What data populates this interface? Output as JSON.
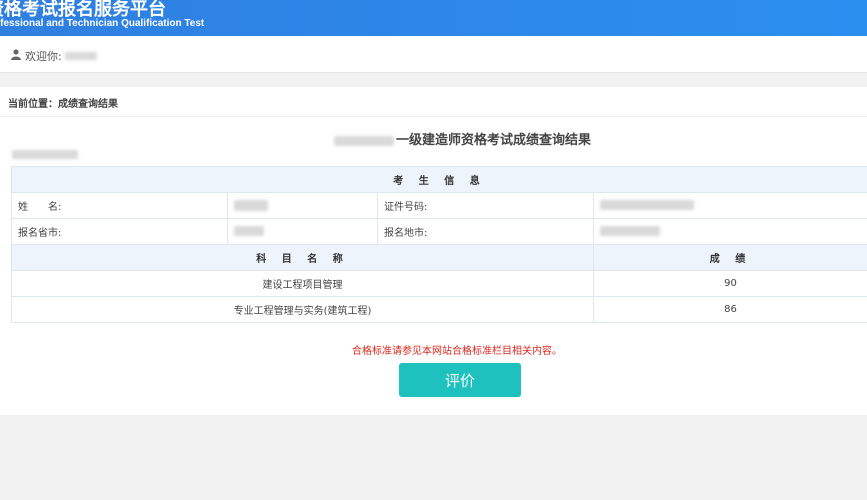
{
  "header": {
    "title_cn": "资格考试报名服务平台",
    "title_en": "ofessional and Technician Qualification Test"
  },
  "userbar": {
    "icon": "user-icon",
    "welcome": "欢迎你:"
  },
  "breadcrumb": "当前位置：成绩查询结果",
  "result_title": "一级建造师资格考试成绩查询结果",
  "candidate_section": {
    "header": "考 生 信 息",
    "name_label": "姓　　名:",
    "id_label": "证件号码:",
    "province_label": "报名省市:",
    "city_label": "报名地市:"
  },
  "score_table": {
    "subject_header": "科 目 名 称",
    "score_header": "成 绩",
    "rows": [
      {
        "subject": "建设工程项目管理",
        "score": "90"
      },
      {
        "subject": "专业工程管理与实务(建筑工程)",
        "score": "86"
      }
    ]
  },
  "note": "合格标准请参见本网站合格标准栏目相关内容。",
  "evaluate_button": "评价",
  "colors": {
    "header_blue": "#2b8ff0",
    "note_red": "#d9281e",
    "button_teal": "#1ec1be",
    "section_bg": "#eef4fc"
  }
}
